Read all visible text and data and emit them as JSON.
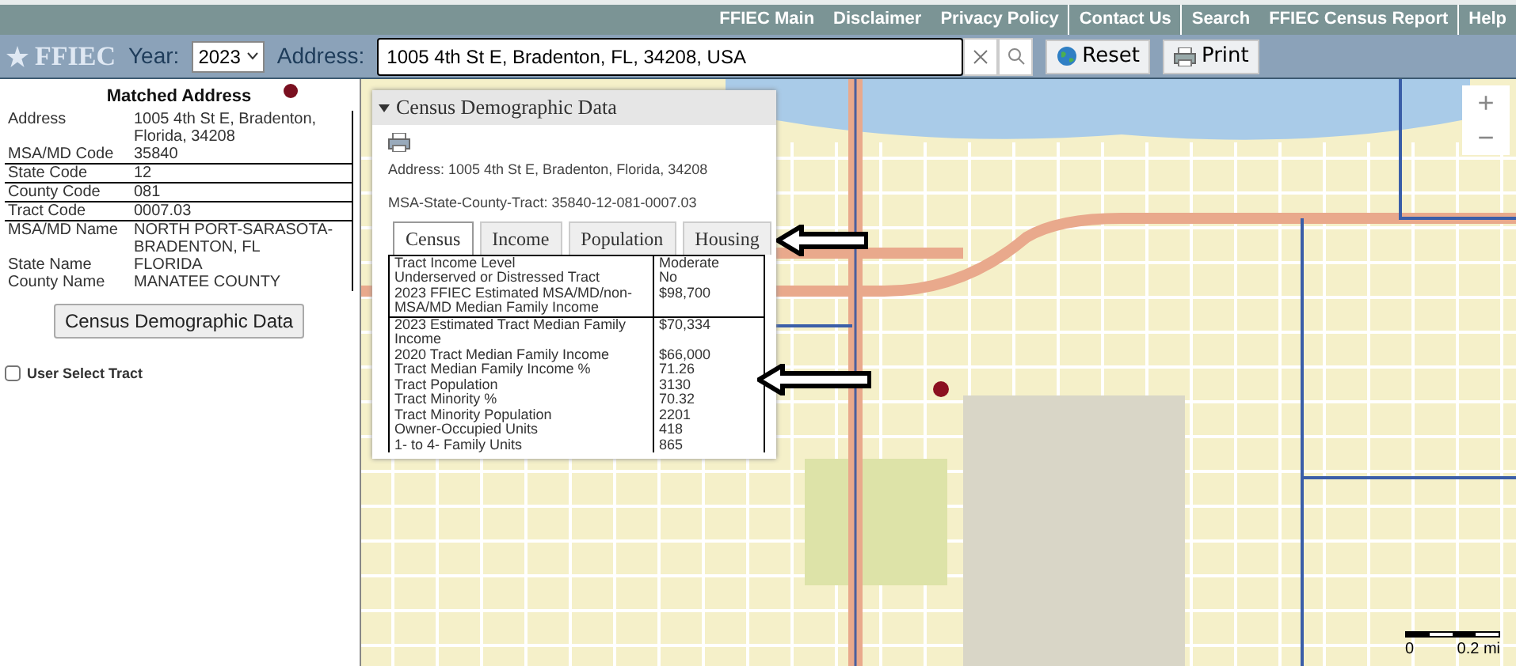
{
  "top_links": [
    {
      "label": "FFIEC Main",
      "divider": false
    },
    {
      "label": "Disclaimer",
      "divider": false
    },
    {
      "label": "Privacy Policy",
      "divider": true
    },
    {
      "label": "Contact Us",
      "divider": true
    },
    {
      "label": "Search",
      "divider": false
    },
    {
      "label": "FFIEC Census Report",
      "divider": true
    },
    {
      "label": "Help",
      "divider": false
    }
  ],
  "toolbar": {
    "logo": "FFIEC",
    "year_label": "Year:",
    "year": "2023",
    "address_label": "Address:",
    "address_value": "1005 4th St E, Bradenton, FL, 34208, USA",
    "buttons": [
      {
        "kind": "reset",
        "label": "Reset"
      },
      {
        "kind": "print",
        "label": "Print"
      }
    ]
  },
  "matched_address": {
    "title": "Matched Address",
    "rows": [
      {
        "label": "Address",
        "value": "1005 4th St E, Bradenton, Florida, 34208"
      },
      {
        "label": "MSA/MD Code",
        "value": "35840"
      },
      {
        "label": "State Code",
        "value": "12"
      },
      {
        "label": "County Code",
        "value": "081"
      },
      {
        "label": "Tract Code",
        "value": "0007.03"
      },
      {
        "label": "MSA/MD Name",
        "value": "NORTH PORT-SARASOTA-BRADENTON, FL"
      },
      {
        "label": "State Name",
        "value": "FLORIDA"
      },
      {
        "label": "County Name",
        "value": "MANATEE COUNTY"
      }
    ],
    "button": "Census Demographic Data",
    "user_select_tract": {
      "label": "User Select Tract",
      "checked": false
    }
  },
  "popup": {
    "title": "Census Demographic Data",
    "expanded": true,
    "address": "Address: 1005 4th St E, Bradenton, Florida, 34208",
    "tract": "MSA-State-County-Tract: 35840-12-081-0007.03",
    "tabs": [
      {
        "label": "Census",
        "selected": true
      },
      {
        "label": "Income",
        "selected": false
      },
      {
        "label": "Population",
        "selected": false
      },
      {
        "label": "Housing",
        "selected": false
      }
    ],
    "rows": [
      {
        "label": "Tract Income Level",
        "value": "Moderate"
      },
      {
        "label": "Underserved or Distressed Tract",
        "value": "No"
      },
      {
        "label": "2023 FFIEC Estimated MSA/MD/non-MSA/MD Median Family Income",
        "value": "$98,700"
      },
      {
        "label": "2023 Estimated Tract Median Family Income",
        "value": "$70,334"
      },
      {
        "label": "2020 Tract Median Family Income",
        "value": "$66,000"
      },
      {
        "label": "Tract Median Family Income %",
        "value": "71.26"
      },
      {
        "label": "Tract Population",
        "value": "3130"
      },
      {
        "label": "Tract Minority %",
        "value": "70.32"
      },
      {
        "label": "Tract Minority Population",
        "value": "2201"
      },
      {
        "label": "Owner-Occupied Units",
        "value": "418"
      },
      {
        "label": "1- to 4- Family Units",
        "value": "865"
      }
    ]
  },
  "map": {
    "zoom_in": "+",
    "zoom_out": "−",
    "scale_start": "0",
    "scale_end": "0.2 mi"
  }
}
